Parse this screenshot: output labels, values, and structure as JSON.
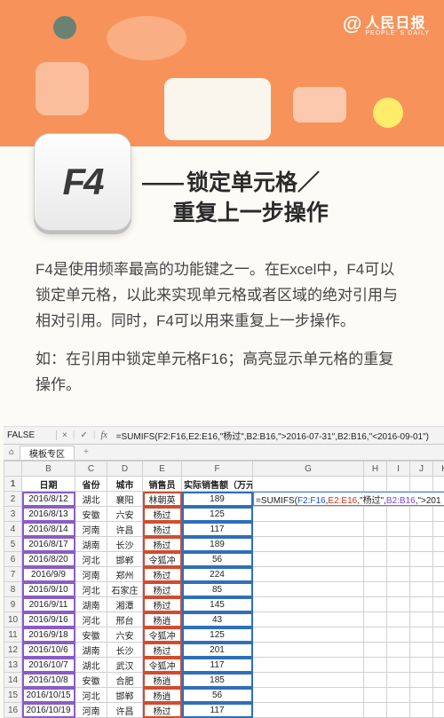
{
  "brand": {
    "at": "@",
    "name": "人民日报",
    "sub": "PEOPLE' S DAILY"
  },
  "key": {
    "label": "F4"
  },
  "headline": {
    "dash": "——",
    "line1": "锁定单元格／",
    "line2": "重复上一步操作"
  },
  "paragraphs": {
    "p1": "F4是使用频率最高的功能键之一。在Excel中，F4可以锁定单元格，以此来实现单元格或者区域的绝对引用与相对引用。同时，F4可以用来重复上一步操作。",
    "p2": "如：在引用中锁定单元格F16；高亮显示单元格的重复操作。"
  },
  "excel": {
    "namebox": "FALSE",
    "fx_buttons": {
      "cancel": "×",
      "confirm": "✓",
      "fx": "fx"
    },
    "formula": "=SUMIFS(F2:F16,E2:E16,\"杨过\",B2:B16,\">2016-07-31\",B2:B16,\"<2016-09-01\")",
    "tab": "模板专区",
    "tab_plus": "+",
    "col_letters": [
      "",
      "B",
      "C",
      "D",
      "E",
      "F",
      "G",
      "H",
      "I",
      "J",
      "K"
    ],
    "data_headers": [
      "日期",
      "省份",
      "城市",
      "销售员",
      "实际销售额（万元）"
    ],
    "rows": [
      {
        "n": 2,
        "b": "2016/8/12",
        "c": "湖北",
        "d": "襄阳",
        "e": "林朝英",
        "f": "189"
      },
      {
        "n": 3,
        "b": "2016/8/13",
        "c": "安徽",
        "d": "六安",
        "e": "杨过",
        "f": "125"
      },
      {
        "n": 4,
        "b": "2016/8/14",
        "c": "河南",
        "d": "许昌",
        "e": "杨过",
        "f": "117"
      },
      {
        "n": 5,
        "b": "2016/8/17",
        "c": "湖南",
        "d": "长沙",
        "e": "杨过",
        "f": "189"
      },
      {
        "n": 6,
        "b": "2016/8/20",
        "c": "河北",
        "d": "邯郸",
        "e": "令狐冲",
        "f": "56"
      },
      {
        "n": 7,
        "b": "2016/9/9",
        "c": "河南",
        "d": "郑州",
        "e": "杨过",
        "f": "224"
      },
      {
        "n": 8,
        "b": "2016/9/10",
        "c": "河北",
        "d": "石家庄",
        "e": "杨过",
        "f": "85"
      },
      {
        "n": 9,
        "b": "2016/9/11",
        "c": "湖南",
        "d": "湘潭",
        "e": "杨过",
        "f": "145"
      },
      {
        "n": 10,
        "b": "2016/9/16",
        "c": "河北",
        "d": "邢台",
        "e": "杨逍",
        "f": "43"
      },
      {
        "n": 11,
        "b": "2016/9/18",
        "c": "安徽",
        "d": "六安",
        "e": "令狐冲",
        "f": "125"
      },
      {
        "n": 12,
        "b": "2016/10/6",
        "c": "湖南",
        "d": "长沙",
        "e": "杨过",
        "f": "201"
      },
      {
        "n": 13,
        "b": "2016/10/7",
        "c": "湖北",
        "d": "武汉",
        "e": "令狐冲",
        "f": "117"
      },
      {
        "n": 14,
        "b": "2016/10/8",
        "c": "安徽",
        "d": "合肥",
        "e": "杨逍",
        "f": "185"
      },
      {
        "n": 15,
        "b": "2016/10/15",
        "c": "河北",
        "d": "邯郸",
        "e": "杨逍",
        "f": "56"
      },
      {
        "n": 16,
        "b": "2016/10/19",
        "c": "河南",
        "d": "许昌",
        "e": "杨过",
        "f": "117"
      }
    ],
    "editing_cell": {
      "prefix": "=SUMIFS(",
      "range1": "F2:F16",
      "comma1": ",",
      "range2": "E2:E16",
      "comma2": ",\"杨过\",",
      "range3": "B2:B16",
      "tail": ",\">201"
    }
  }
}
